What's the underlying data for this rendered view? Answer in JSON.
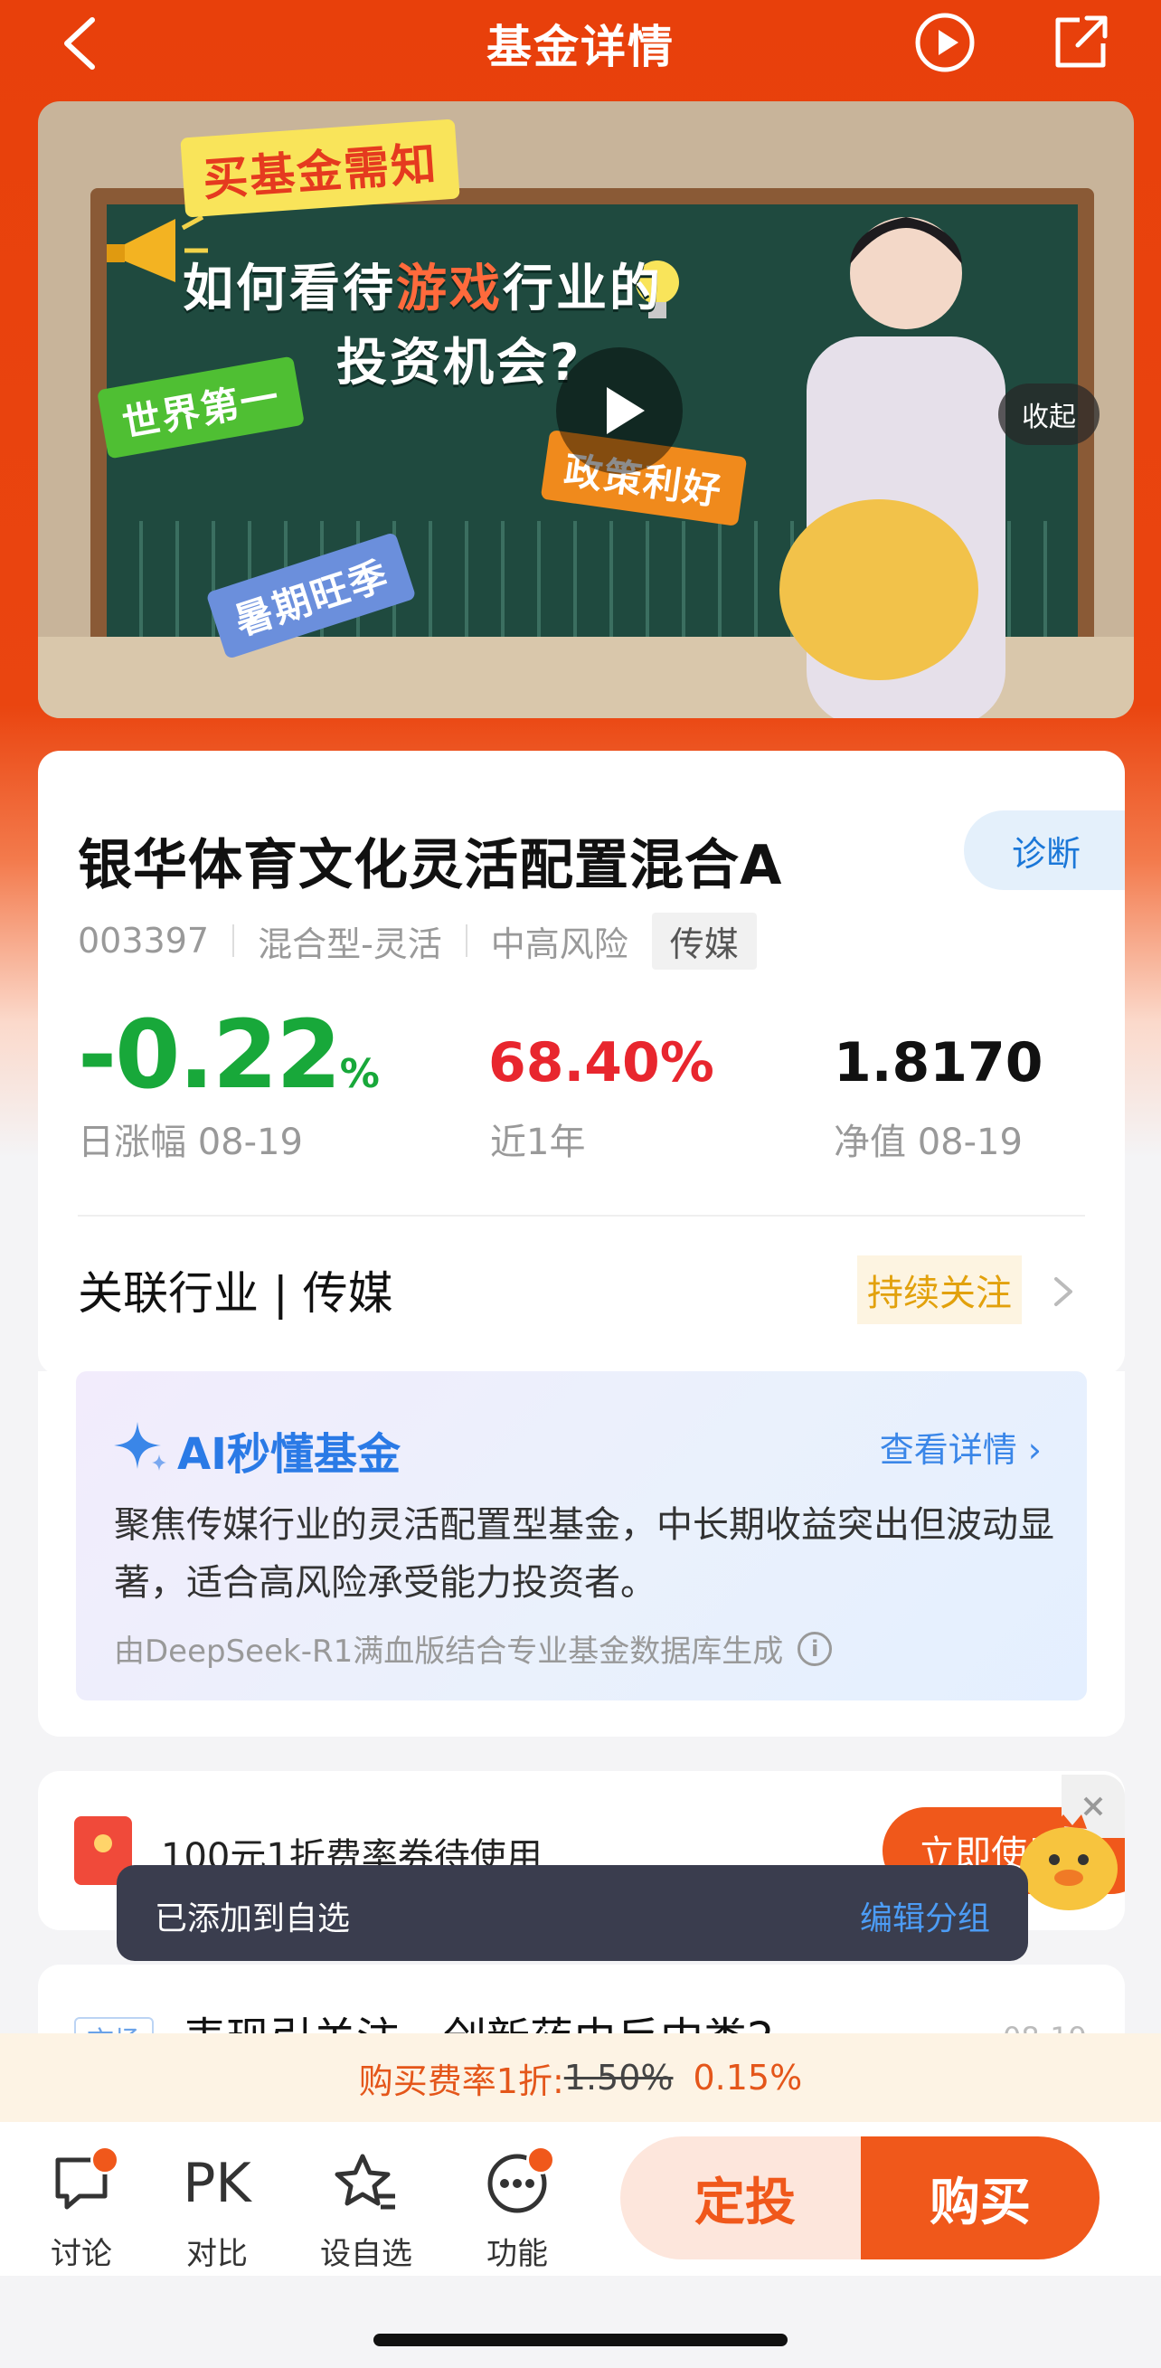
{
  "header": {
    "title": "基金详情"
  },
  "banner": {
    "sticker_top": "买基金需知",
    "board_line1_a": "如何看待",
    "board_line1_hl": "游戏",
    "board_line1_b": "行业的",
    "board_line2": "投资机会?",
    "sticker_left": "世界第一",
    "sticker_right": "政策利好",
    "sticker_bottom": "暑期旺季",
    "collapse_label": "收起"
  },
  "fund": {
    "name": "银华体育文化灵活配置混合A",
    "diagnose_label": "诊断",
    "code": "003397",
    "type": "混合型-灵活",
    "risk": "中高风险",
    "sector_tag": "传媒",
    "daily_change": "-0.22",
    "daily_change_unit": "%",
    "daily_change_label": "日涨幅 08-19",
    "one_year": "68.40%",
    "one_year_label": "近1年",
    "nav": "1.8170",
    "nav_label": "净值 08-19",
    "industry": "关联行业 | 传媒",
    "follow_label": "持续关注"
  },
  "ai": {
    "title": "AI秒懂基金",
    "more_label": "查看详情",
    "description": "聚焦传媒行业的灵活配置型基金，中长期收益突出但波动显著，适合高风险承受能力投资者。",
    "source": "由DeepSeek-R1满血版结合专业基金数据库生成"
  },
  "coupon": {
    "text": "100元1折费率券待使用",
    "button_label": "立即使用"
  },
  "toast": {
    "message": "已添加到自选",
    "action_label": "编辑分组"
  },
  "news": {
    "tag": "市场",
    "title": "表现引关注，创新药由反中类2",
    "date": "08-19"
  },
  "fee": {
    "prefix": "购买费率1折:",
    "original": "1.50%",
    "discounted": "0.15%"
  },
  "bottom": {
    "tabs": [
      {
        "label": "讨论",
        "icon": "chat-bubble-icon"
      },
      {
        "label": "对比",
        "icon": "PK"
      },
      {
        "label": "设自选",
        "icon": "star-list-icon"
      },
      {
        "label": "功能",
        "icon": "more-dots-icon"
      }
    ],
    "sip_label": "定投",
    "buy_label": "购买"
  },
  "colors": {
    "brand": "#e8400b",
    "up": "#e8262e",
    "down": "#18a83a",
    "link": "#1a77d8"
  }
}
